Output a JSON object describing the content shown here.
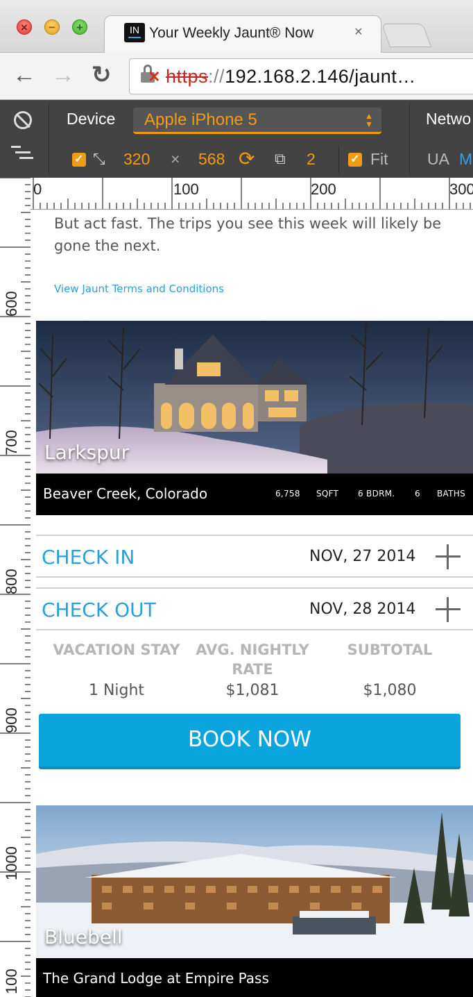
{
  "browser": {
    "tab_title": "Your Weekly Jaunt® Now",
    "tab_favicon_text": "IN",
    "tab_close": "×",
    "url_protocol": "https",
    "url_separator": "://",
    "url_rest": "192.168.2.146/jaunt…",
    "back_glyph": "←",
    "forward_glyph": "→",
    "reload_glyph": "↻"
  },
  "devtools": {
    "device_label": "Device",
    "device_value": "Apple iPhone 5",
    "network_label": "Netwo",
    "width": "320",
    "times": "×",
    "height": "568",
    "dpr": "2",
    "fit_label": "Fit",
    "ua_label": "UA",
    "ua_value": "M"
  },
  "rulers": {
    "top_labels": [
      "0",
      "100",
      "200",
      "300"
    ],
    "left_labels": [
      "600",
      "700",
      "800",
      "900",
      "1000",
      "100"
    ]
  },
  "page": {
    "intro_text": "But act fast. The trips you see this week will likely be gone the next.",
    "terms_link": "View Jaunt Terms and Conditions",
    "listing1": {
      "name": "Larkspur",
      "location": "Beaver Creek, Colorado",
      "sqft_value": "6,758",
      "sqft_label": "SQFT",
      "bedrooms": "6 BDRM.",
      "baths_value": "6",
      "baths_label": "BATHS"
    },
    "check_in": {
      "label": "CHECK IN",
      "value": "NOV, 27 2014"
    },
    "check_out": {
      "label": "CHECK OUT",
      "value": "NOV, 28 2014"
    },
    "summary": {
      "headers": [
        "VACATION STAY",
        "AVG. NIGHTLY RATE",
        "SUBTOTAL"
      ],
      "values": [
        "1 Night",
        "$1,081",
        "$1,080"
      ]
    },
    "book_button": "BOOK NOW",
    "listing2": {
      "name": "Bluebell",
      "location": "The Grand Lodge at Empire Pass"
    }
  }
}
